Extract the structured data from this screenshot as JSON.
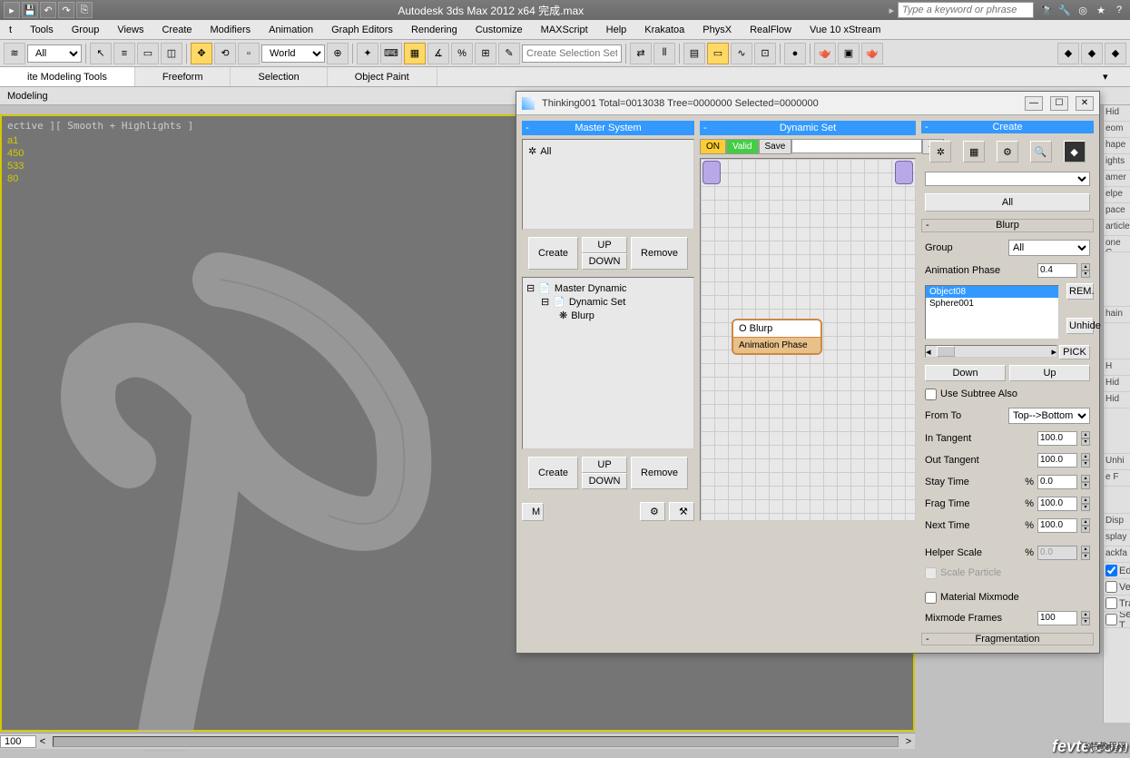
{
  "titlebar": {
    "title": "Autodesk 3ds Max  2012 x64     完成.max",
    "search_placeholder": "Type a keyword or phrase"
  },
  "menu": [
    "t",
    "Tools",
    "Group",
    "Views",
    "Create",
    "Modifiers",
    "Animation",
    "Graph Editors",
    "Rendering",
    "Customize",
    "MAXScript",
    "Help",
    "Krakatoa",
    "PhysX",
    "RealFlow",
    "Vue 10 xStream"
  ],
  "toolbar": {
    "dropdown1": "All",
    "coord": "World",
    "sel_set": "Create Selection Set"
  },
  "ribbon": {
    "tabs": [
      "ite Modeling Tools",
      "Freeform",
      "Selection",
      "Object Paint"
    ],
    "sub": "Modeling"
  },
  "viewport": {
    "label": "ective ][ Smooth + Highlights ]",
    "stats": [
      "a1",
      "450",
      "533",
      "",
      "80"
    ]
  },
  "timeline": {
    "frame": "100"
  },
  "floating": {
    "title": "Thinking001  Total=0013038  Tree=0000000  Selected=0000000",
    "master_system": "Master System",
    "all": "All",
    "create": "Create",
    "up": "UP",
    "down": "DOWN",
    "remove": "Remove",
    "m": "M",
    "tree": {
      "root": "Master Dynamic",
      "child1": "Dynamic Set",
      "child2": "Blurp"
    },
    "dynamic_set": "Dynamic Set",
    "on": "ON",
    "valid": "Valid",
    "save": "Save",
    "node": {
      "title": "O Blurp",
      "sub": "Animation Phase"
    },
    "create_panel": {
      "title": "Create",
      "all": "All",
      "blurp": "Blurp",
      "group_lbl": "Group",
      "group_val": "All",
      "anim_phase_lbl": "Animation Phase",
      "anim_phase_val": "0.4",
      "objects": [
        "Object08",
        "Sphere001"
      ],
      "rem": "REM.",
      "unhide": "Unhide",
      "pick": "PICK",
      "down": "Down",
      "up": "Up",
      "use_subtree": "Use Subtree Also",
      "from_to_lbl": "From To",
      "from_to_val": "Top-->Bottom",
      "in_tangent_lbl": "In Tangent",
      "in_tangent_val": "100.0",
      "out_tangent_lbl": "Out Tangent",
      "out_tangent_val": "100.0",
      "stay_time_lbl": "Stay Time",
      "stay_time_val": "0.0",
      "frag_time_lbl": "Frag Time",
      "frag_time_val": "100.0",
      "next_time_lbl": "Next Time",
      "next_time_val": "100.0",
      "pct": "%",
      "helper_scale_lbl": "Helper Scale",
      "helper_scale_val": "0.0",
      "scale_particle": "Scale Particle",
      "material_mix": "Material Mixmode",
      "mixmode_frames_lbl": "Mixmode Frames",
      "mixmode_frames_val": "100",
      "fragmentation": "Fragmentation"
    }
  },
  "right_panel": {
    "items": [
      "Hid",
      "eom",
      "hape",
      "ights",
      "amer",
      "elpe",
      "pace",
      "article",
      "one C",
      "hain",
      "e F"
    ],
    "cb": [
      "Edges",
      "Vertex",
      "Trajec",
      "See-T"
    ],
    "btns": [
      "H",
      "Hid",
      "Hid",
      "Unhi",
      "Disp",
      "splay",
      "ackfa"
    ]
  },
  "watermark": "fevte.com",
  "watermark2": "飞特教程网"
}
